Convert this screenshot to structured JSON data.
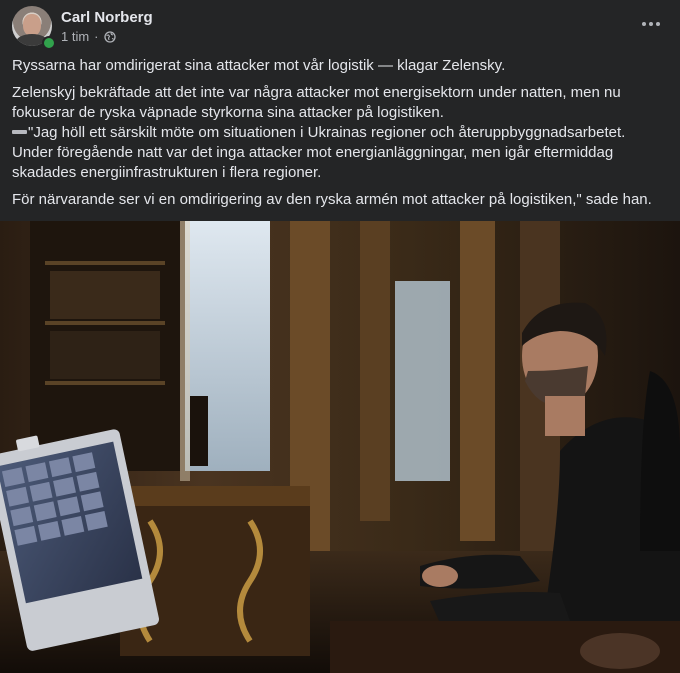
{
  "post": {
    "author": "Carl Norberg",
    "time": "1 tim",
    "separator": "·",
    "audience_icon": "globe-icon",
    "more_icon": "more-horizontal-icon",
    "paragraphs": {
      "p1": "Ryssarna har omdirigerat sina attacker mot vår logistik — klagar Zelensky.",
      "p2a": "Zelenskyj bekräftade att det inte var några attacker mot energisektorn under natten, men nu fokuserar de ryska väpnade styrkorna sina attacker på logistiken.",
      "p2b": "\"Jag höll ett särskilt möte om situationen i Ukrainas regioner och återuppbyggnadsarbetet. Under föregående natt var det inga attacker mot energianläggningar, men igår eftermiddag skadades energiinfrastrukturen i flera regioner.",
      "p3": "För närvarande ser vi en omdirigering av den ryska armén mot attacker på logistiken,\" sade han."
    },
    "emoji": "minus-emoji"
  },
  "colors": {
    "background": "#242526",
    "text": "#e4e6eb",
    "secondary_text": "#b0b3b8",
    "online": "#31a24c"
  }
}
